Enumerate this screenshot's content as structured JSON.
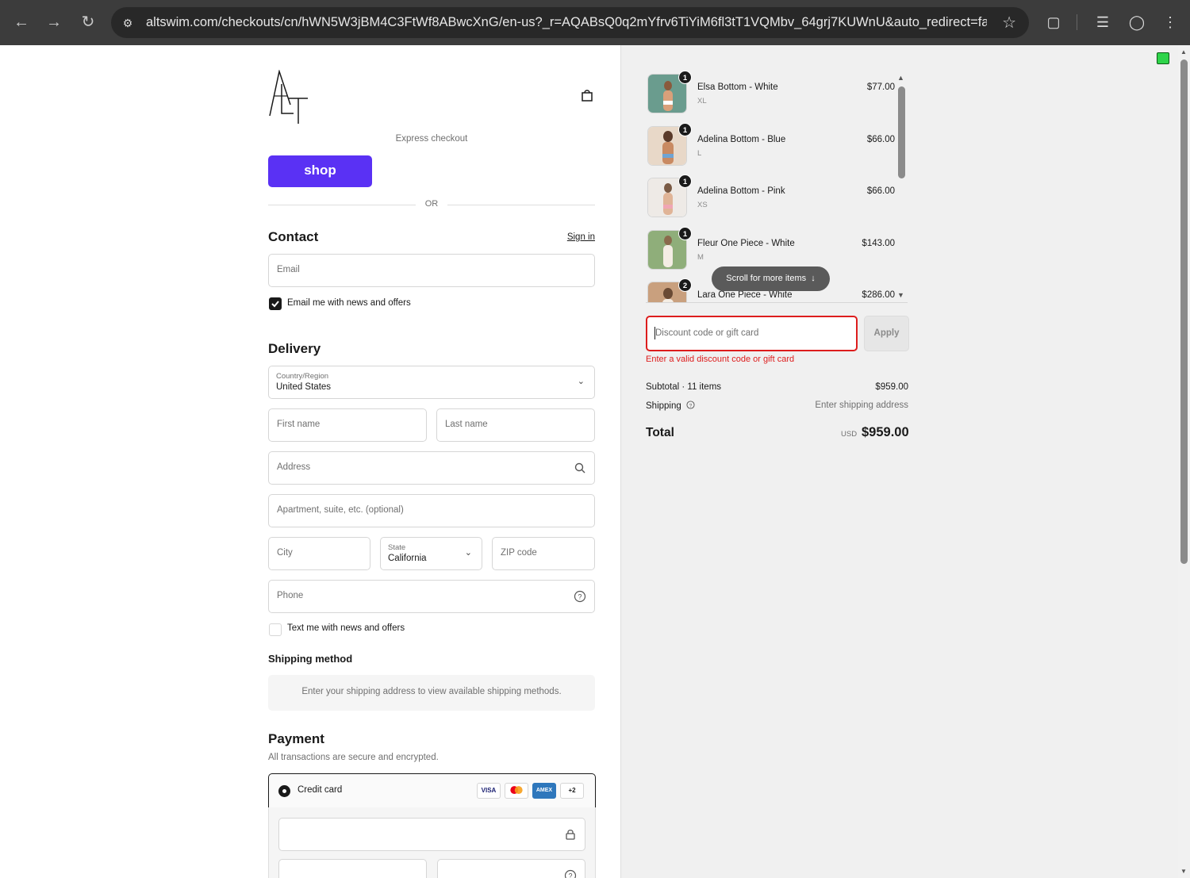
{
  "browser": {
    "url": "altswim.com/checkouts/cn/hWN5W3jBM4C3FtWf8ABwcXnG/en-us?_r=AQABsQ0q2mYfrv6TiYiM6fl3tT1VQMbv_64grj7KUWnU&auto_redirect=fal..."
  },
  "header": {
    "logo_text": "ALT",
    "express_checkout": "Express checkout",
    "shop_button": "shop",
    "or_divider": "OR"
  },
  "contact": {
    "title": "Contact",
    "sign_in": "Sign in",
    "email_placeholder": "Email",
    "email_news_label": "Email me with news and offers",
    "email_news_checked": true
  },
  "delivery": {
    "title": "Delivery",
    "country_label": "Country/Region",
    "country_value": "United States",
    "first_name_placeholder": "First name",
    "last_name_placeholder": "Last name",
    "address_placeholder": "Address",
    "apartment_placeholder": "Apartment, suite, etc. (optional)",
    "city_placeholder": "City",
    "state_label": "State",
    "state_value": "California",
    "zip_placeholder": "ZIP code",
    "phone_placeholder": "Phone",
    "text_news_label": "Text me with news and offers",
    "text_news_checked": false
  },
  "shipping_method": {
    "title": "Shipping method",
    "notice": "Enter your shipping address to view available shipping methods."
  },
  "payment": {
    "title": "Payment",
    "subtitle": "All transactions are secure and encrypted.",
    "credit_card_label": "Credit card",
    "card_logos": [
      "VISA",
      "mastercard",
      "AMEX",
      "+2"
    ]
  },
  "order_summary": {
    "items": [
      {
        "name": "Elsa Bottom - White",
        "variant": "XL",
        "price": "$77.00",
        "qty": "1"
      },
      {
        "name": "Adelina Bottom - Blue",
        "variant": "L",
        "price": "$66.00",
        "qty": "1"
      },
      {
        "name": "Adelina Bottom - Pink",
        "variant": "XS",
        "price": "$66.00",
        "qty": "1"
      },
      {
        "name": "Fleur One Piece - White",
        "variant": "M",
        "price": "$143.00",
        "qty": "1"
      },
      {
        "name": "Lara One Piece - White",
        "variant": "",
        "price": "$286.00",
        "qty": "2"
      }
    ],
    "scroll_hint": "Scroll for more items",
    "discount_placeholder": "Discount code or gift card",
    "apply_button": "Apply",
    "discount_error": "Enter a valid discount code or gift card",
    "subtotal_label": "Subtotal · 11 items",
    "subtotal_value": "$959.00",
    "shipping_label": "Shipping",
    "shipping_value": "Enter shipping address",
    "total_label": "Total",
    "total_currency": "USD",
    "total_value": "$959.00"
  },
  "colors": {
    "shop_purple": "#5a31f4",
    "error_red": "#dd1d1d",
    "summary_bg": "#f0f0f0"
  }
}
